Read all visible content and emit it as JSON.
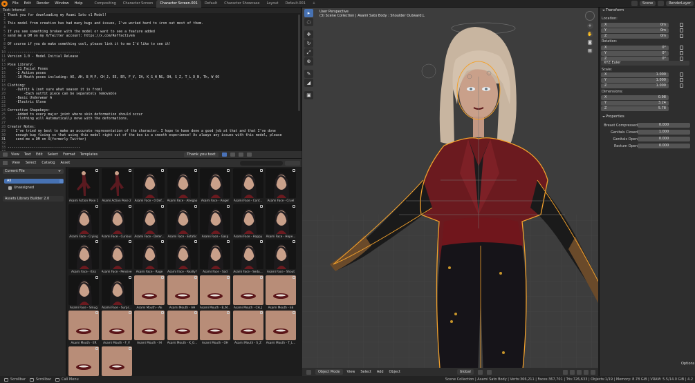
{
  "topbar": {
    "menu": [
      "File",
      "Edit",
      "Render",
      "Window",
      "Help"
    ],
    "tabs": [
      "Compositing",
      "Character Screen",
      "Character Screen.001",
      "Default",
      "Character Showcase",
      "Layout",
      "Default.001",
      "+"
    ],
    "active_tab": "Character Screen.001",
    "scene": "Scene",
    "view_layer": "RenderLayer"
  },
  "text_editor": {
    "header": "Text: Internal",
    "lines": [
      "Thank you for downloading my Asami Sato v1 Model!",
      "",
      "This model from creation has had many bugs and issues, I've worked hard to iron out most of them.",
      "",
      "If you see something broken with the model or want to see a feature added",
      "send me a DM on my X/Twitter account: https://x.com/Reffactivem",
      "",
      "Of course if you do make something cool, please link it to me I'd like to see it!",
      "",
      "------------------------------------",
      "Version 1.0 - Model Initial Release",
      "",
      "Pose Library:",
      "    -21 Facial Poses",
      "    -2 Action poses",
      "    -18 Mouth poses including: AE, AH, B_M_P, CH_J, EE, ER, F_V, IH, K_G_H_NG, OH, S_Z, T_L_D_N, Th, W_OO",
      "",
      "Clothing:",
      "    -Outfit A (not sure what season it is from)",
      "        -Each outfit piece can be separately removable",
      "    -Basic Underwear A",
      "    -Electric Glove",
      "",
      "Corrective Shapekeys:",
      "    -Added to every major joint where skin deformation should occur",
      "    -Clothing will Automatically move with the deformations.",
      "",
      "Creator Notes:",
      "    I've tried my best to make an accurate representation of the character. I hope to have done a good job at that and that I've done",
      "    enough bug fixing so that using this model right out of the box is a smooth experience! As always any issues with this model, please",
      "    send me a DM on X(formerly Twitter)",
      "",
      "------------------------------------",
      ""
    ],
    "footer_menu": [
      "View",
      "Text",
      "Edit",
      "Select",
      "Format",
      "Templates"
    ],
    "text_name": "Thank you text"
  },
  "asset_browser": {
    "menu": [
      "View",
      "Select",
      "Catalog",
      "Asset"
    ],
    "search_placeholder": "",
    "library": "Current File",
    "catalog": "All",
    "unassigned": "Unassigned",
    "add_on": "Assets Library Builder 2.0",
    "assets": [
      "Asami Action Pose 1",
      "Asami Action Pose 2",
      "Asami Face - 0 Def...",
      "Asami Face - Ahegao",
      "Asami Face - Anger",
      "Asami Face - Conf...",
      "Asami Face - Cruel",
      "Asami Face - Crying",
      "Asami Face - Curious",
      "Asami Face - Deter...",
      "Asami Face - Estatic",
      "Asami Face - Gasp",
      "Asami Face - Happy",
      "Asami Face - Hope...",
      "Asami Face - Kiss",
      "Asami Face - Pensive",
      "Asami Face - Rage",
      "Asami Face - Really?",
      "Asami Face - Sad",
      "Asami Face - Sedu...",
      "Asami Face - Shout",
      "Asami Face - Smug",
      "Asami Face - Surpr...",
      "Asami Mouth - AE",
      "Asami Mouth - AH",
      "Asami Mouth - B_M...",
      "Asami Mouth - CH_J",
      "Asami Mouth - EE",
      "Asami Mouth - ER",
      "Asami Mouth - F_V",
      "Asami Mouth - IH",
      "Asami Mouth - K_G...",
      "Asami Mouth - OH",
      "Asami Mouth - S_Z",
      "Asami Mouth - T_L...",
      "",
      ""
    ]
  },
  "viewport": {
    "title": "User Perspective",
    "subtitle": "(3) Scene Collection | Asami Sato Body : Shoulder Outward.L",
    "mode": "Object Mode",
    "menu": [
      "View",
      "Select",
      "Add",
      "Object"
    ],
    "orientation": "Global",
    "options": "Options",
    "colors": {
      "outline": "#f2a12c",
      "bg": "#3d3d3d",
      "jacket": "#6b1a1f",
      "skin": "#c9a08a",
      "hair": "#cdbba8",
      "pants": "#151318"
    }
  },
  "properties": {
    "transform_header": "Transform",
    "location_label": "Location:",
    "rotation_label": "Rotation:",
    "rotation_mode": "XYZ Euler",
    "scale_label": "Scale:",
    "dimensions_label": "Dimensions:",
    "location": [
      {
        "axis": "X",
        "value": "0m"
      },
      {
        "axis": "Y",
        "value": "0m"
      },
      {
        "axis": "Z",
        "value": "0m"
      }
    ],
    "rotation": [
      {
        "axis": "X",
        "value": "0°"
      },
      {
        "axis": "Y",
        "value": "0°"
      },
      {
        "axis": "Z",
        "value": "0°"
      }
    ],
    "scale": [
      {
        "axis": "X",
        "value": "1.000"
      },
      {
        "axis": "Y",
        "value": "1.000"
      },
      {
        "axis": "Z",
        "value": "1.000"
      }
    ],
    "dimensions": [
      {
        "axis": "X",
        "value": "0.98"
      },
      {
        "axis": "Y",
        "value": "3.24"
      },
      {
        "axis": "Z",
        "value": "5.78"
      }
    ],
    "properties_header": "Properties",
    "custom": [
      {
        "key": "Breast Compressed",
        "value": "0.000"
      },
      {
        "key": "Genitals Closed",
        "value": "1.000"
      },
      {
        "key": "Genitals Open",
        "value": "0.000"
      },
      {
        "key": "Rectum Open",
        "value": "0.000"
      }
    ]
  },
  "status": {
    "keys": [
      "Scrollbar",
      "Scrollbar",
      "Call Menu"
    ],
    "stats": "Scene Collection | Asami Sato Body | Verts:366,211 | Faces:367,701 | Tris:726,633 | Objects:1/19 | Memory: 8.78 GiB | VRAM: 5.5/14.0 GiB | 4.2"
  }
}
